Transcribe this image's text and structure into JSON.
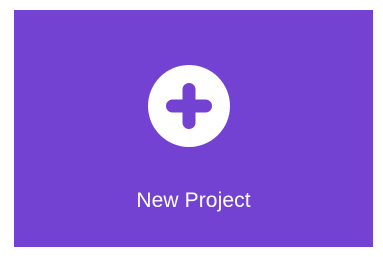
{
  "tile": {
    "label": "New Project",
    "icon": "plus-circle-icon",
    "background_color": "#7442d3",
    "icon_color": "#ffffff"
  }
}
